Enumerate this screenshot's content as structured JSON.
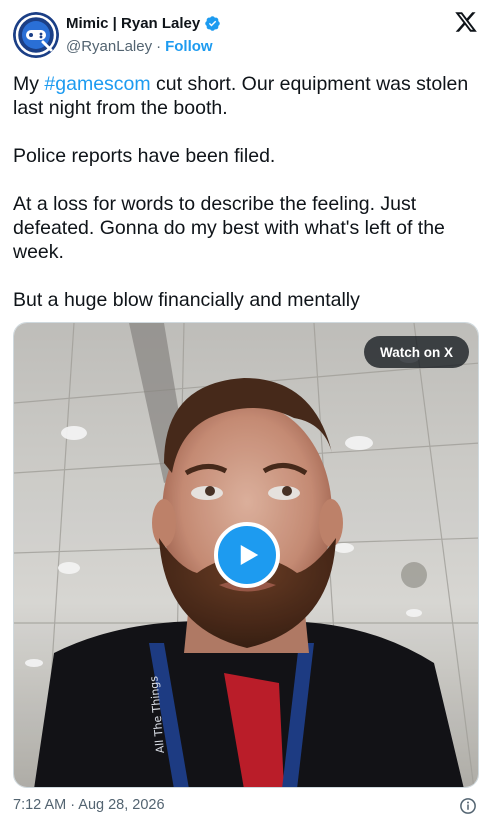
{
  "author": {
    "name": "Mimic | Ryan Laley",
    "handle": "@RyanLaley",
    "separator": "·",
    "follow_label": "Follow",
    "verified": true
  },
  "tweet": {
    "text_before_hashtag": "My ",
    "hashtag": "#gamescom",
    "text_after_hashtag": " cut short. Our equipment was stolen last night from the booth.\n\nPolice reports have been filed.\n\nAt a loss for words to describe the feeling. Just defeated. Gonna do my best with what's left of the week.\n\nBut a huge blow financially and mentally"
  },
  "media": {
    "watch_label": "Watch on X",
    "lanyard_text": "All The Things"
  },
  "footer": {
    "timestamp": "7:12 AM · Aug 28, 2026"
  },
  "colors": {
    "accent": "#1d9bf0",
    "text": "#0f1419",
    "muted": "#536471"
  },
  "icons": {
    "logo": "x-logo-icon",
    "verified": "verified-badge-icon",
    "play": "play-icon",
    "info": "info-icon"
  }
}
